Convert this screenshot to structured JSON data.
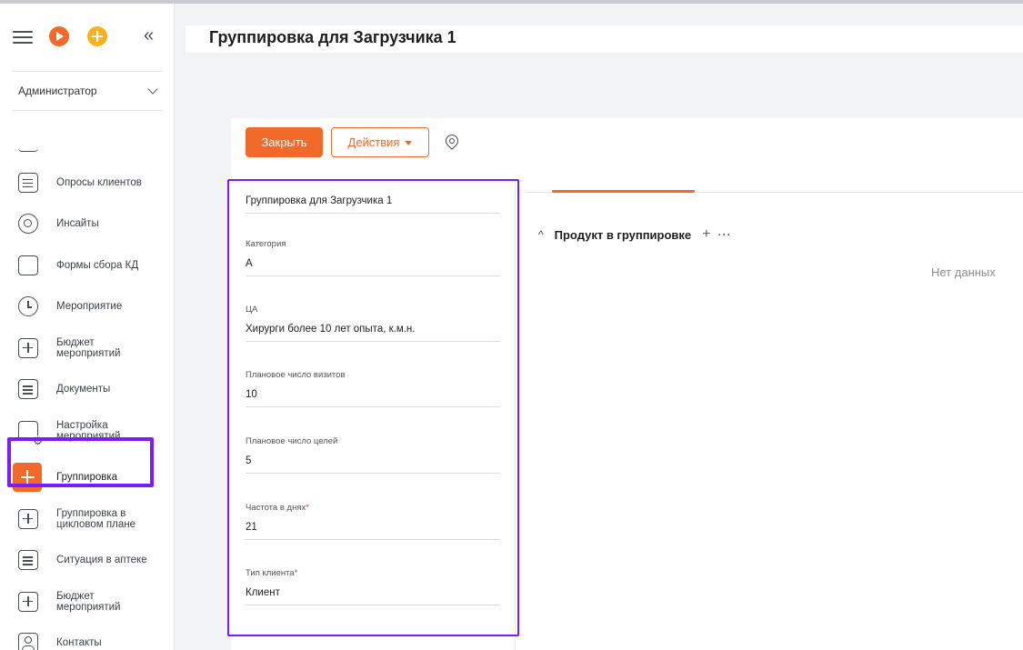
{
  "header": {
    "title": "Группировка для Загрузчика 1"
  },
  "sidebar": {
    "role": "Администратор",
    "collapse_glyph": "«",
    "items": [
      {
        "label": "",
        "icon": "dash-icon"
      },
      {
        "label": "Опросы клиентов",
        "icon": "survey-icon"
      },
      {
        "label": "Инсайты",
        "icon": "target-icon"
      },
      {
        "label": "Формы сбора КД",
        "icon": "form-icon"
      },
      {
        "label": "Мероприятие",
        "icon": "clock-icon"
      },
      {
        "label": "Бюджет мероприятий",
        "icon": "budget-icon"
      },
      {
        "label": "Документы",
        "icon": "document-icon"
      },
      {
        "label": "Настройка мероприятий",
        "icon": "settings-icon"
      },
      {
        "label": "Группировка",
        "icon": "grouping-icon",
        "active": true
      },
      {
        "label": "Группировка в цикловом плане",
        "icon": "grouping-cycle-icon"
      },
      {
        "label": "Ситуация в аптеке",
        "icon": "pharmacy-icon"
      },
      {
        "label": "Бюджет мероприятий",
        "icon": "budget-icon"
      },
      {
        "label": "Контакты",
        "icon": "contact-icon"
      }
    ]
  },
  "toolbar": {
    "close_label": "Закрыть",
    "actions_label": "Действия"
  },
  "form": {
    "name": "Группировка для Загрузчика 1",
    "category_label": "Категория",
    "category_value": "А",
    "ca_label": "ЦА",
    "ca_value": "Хирурги более 10 лет опыта, к.м.н.",
    "visits_label": "Плановое число визитов",
    "visits_value": "10",
    "goals_label": "Плановое число целей",
    "goals_value": "5",
    "freq_label": "Частота в днях",
    "freq_value": "21",
    "client_type_label": "Тип клиента",
    "client_type_value": "Клиент",
    "required_mark": "*"
  },
  "panel": {
    "section_title": "Продукт в группировке",
    "add_glyph": "+",
    "more_glyph": "···",
    "empty_text": "Нет данных"
  },
  "colors": {
    "accent": "#f26a2a",
    "highlight": "#7b1cff"
  }
}
